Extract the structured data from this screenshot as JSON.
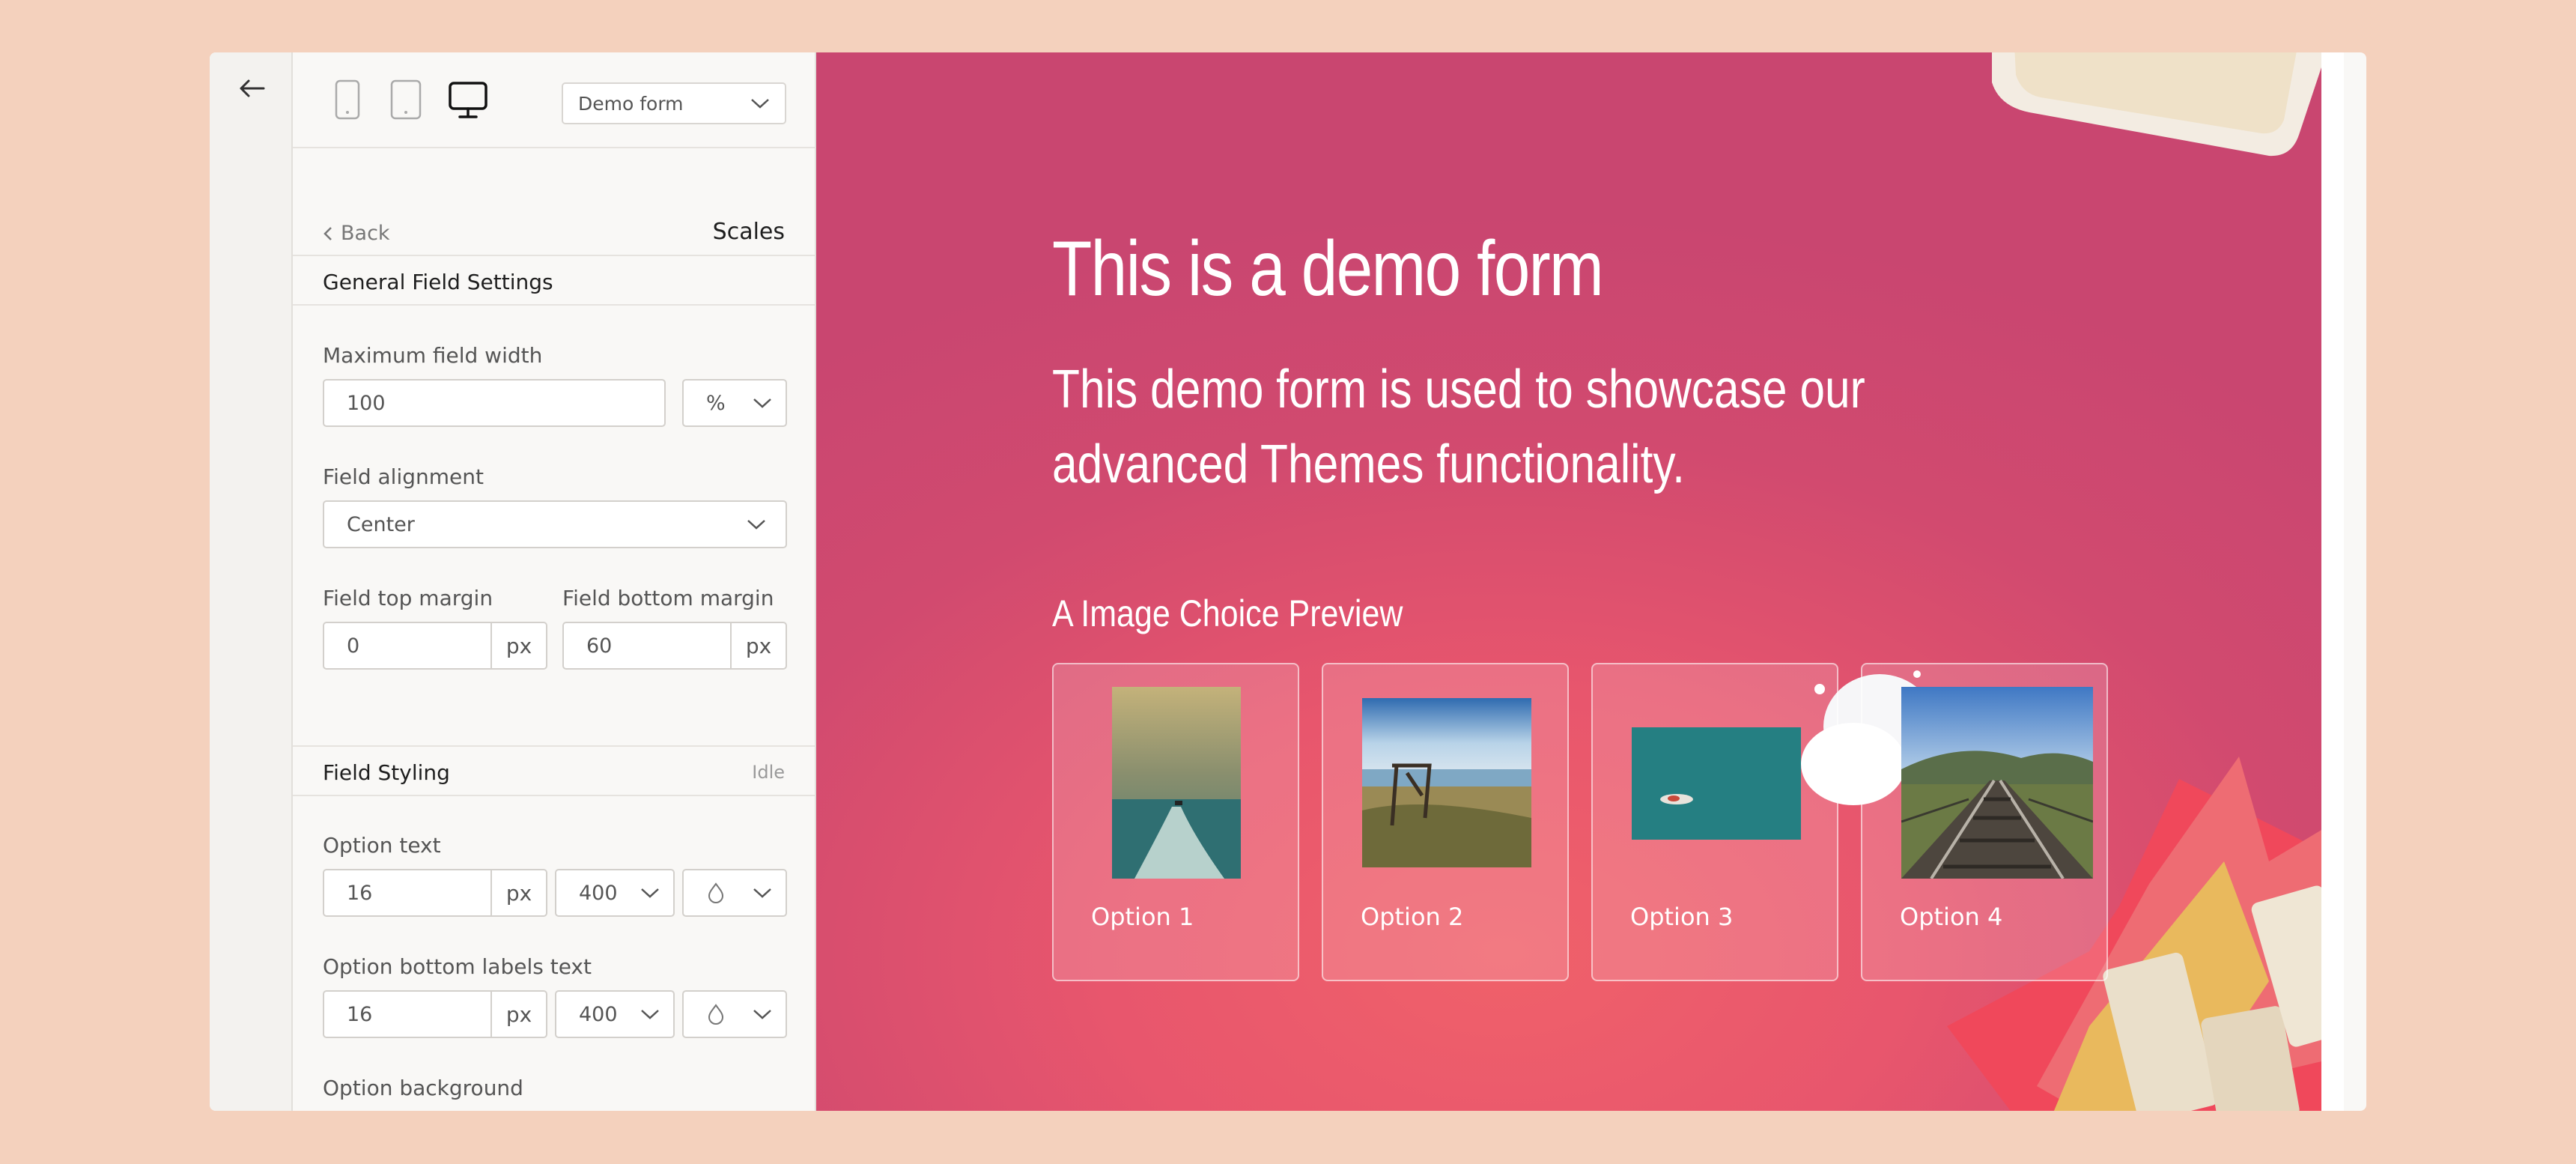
{
  "device_bar": {
    "devices": [
      "mobile-icon",
      "tablet-icon",
      "desktop-icon"
    ],
    "active_device": "desktop",
    "form_select": "Demo form"
  },
  "nav": {
    "back_label": "Back",
    "title": "Scales"
  },
  "general": {
    "title": "General Field Settings",
    "max_width_label": "Maximum field width",
    "max_width_value": "100",
    "max_width_unit": "%",
    "alignment_label": "Field alignment",
    "alignment_value": "Center",
    "top_margin_label": "Field top margin",
    "top_margin_value": "0",
    "top_margin_unit": "px",
    "bottom_margin_label": "Field bottom margin",
    "bottom_margin_value": "60",
    "bottom_margin_unit": "px"
  },
  "styling": {
    "title": "Field Styling",
    "status": "Idle",
    "option_text_label": "Option text",
    "option_text_size": "16",
    "option_text_unit": "px",
    "option_text_weight": "400",
    "bottom_labels_label": "Option bottom labels text",
    "bottom_labels_size": "16",
    "bottom_labels_unit": "px",
    "bottom_labels_weight": "400",
    "background_label": "Option background"
  },
  "preview": {
    "form_title": "This is a demo form",
    "form_description": "This demo form is used to showcase our advanced Themes functionality.",
    "section_label": "A Image Choice Preview",
    "options": [
      {
        "label": "Option 1"
      },
      {
        "label": "Option 2"
      },
      {
        "label": "Option 3"
      },
      {
        "label": "Option 4"
      }
    ]
  },
  "colors": {
    "page_bg": "#f4d1bd",
    "preview_bg": "#d14a6f",
    "panel_bg": "#f9f8f6"
  }
}
